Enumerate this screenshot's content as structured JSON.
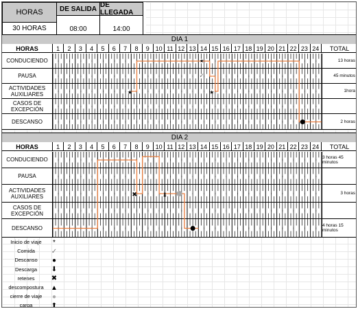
{
  "summary": {
    "hours_header": "HORAS",
    "departure_header": "DE SALIDA",
    "arrival_header": "DE LLEGADA",
    "hours_value": "30 HORAS",
    "departure_value": "08:00",
    "arrival_value": "14:00"
  },
  "hour_numbers": [
    "1",
    "2",
    "3",
    "4",
    "5",
    "6",
    "7",
    "8",
    "9",
    "10",
    "11",
    "12",
    "13",
    "14",
    "15",
    "16",
    "17",
    "18",
    "19",
    "20",
    "21",
    "22",
    "23",
    "24"
  ],
  "day1": {
    "title": "DIA 1",
    "hours_label": "HORAS",
    "total_label": "TOTAL",
    "rows": [
      {
        "label": "CONDUCIENDO",
        "total": "13 horas"
      },
      {
        "label": "PAUSA",
        "total": "45 minutos"
      },
      {
        "label": "ACTIVIDADES AUXILIARES",
        "total": "1hora"
      },
      {
        "label": "CASOS DE EXCEPCIÓN",
        "total": ""
      },
      {
        "label": "DESCANSO",
        "total": "2 horas"
      }
    ]
  },
  "day2": {
    "title": "DIA 2",
    "hours_label": "HORAS",
    "total_label": "TOTAL",
    "rows": [
      {
        "label": "CONDUCIENDO",
        "total": "3 horas 45 minutos"
      },
      {
        "label": "PAUSA",
        "total": ""
      },
      {
        "label": "ACTIVIDADES AUXILIARES",
        "total": "3 horas"
      },
      {
        "label": "CASOS DE EXCEPCIÓN",
        "total": ""
      },
      {
        "label": "DESCANSO",
        "total": "4 horas 15 minutos"
      }
    ]
  },
  "legend": [
    {
      "label": "Inicio de viaje",
      "icon": "star-icon",
      "glyph": "*"
    },
    {
      "label": "Comida",
      "icon": "check-icon",
      "glyph": "✓"
    },
    {
      "label": "Descanso",
      "icon": "filled-circle-icon",
      "glyph": "●"
    },
    {
      "label": "Descarga",
      "icon": "down-arrow-icon",
      "glyph": "⬇"
    },
    {
      "label": "retenes",
      "icon": "retenes-icon",
      "glyph": "✖"
    },
    {
      "label": "descompostura",
      "icon": "triangle-icon",
      "glyph": "▲"
    },
    {
      "label": "cierre de viaje",
      "icon": "gray-circle-icon",
      "glyph": "●"
    },
    {
      "label": "carga",
      "icon": "up-arrow-icon",
      "glyph": "⬆"
    }
  ],
  "colors": {
    "line": "#e87d3e",
    "header_gray": "#c9c9c9",
    "closing_gray": "#a8a8a8"
  }
}
